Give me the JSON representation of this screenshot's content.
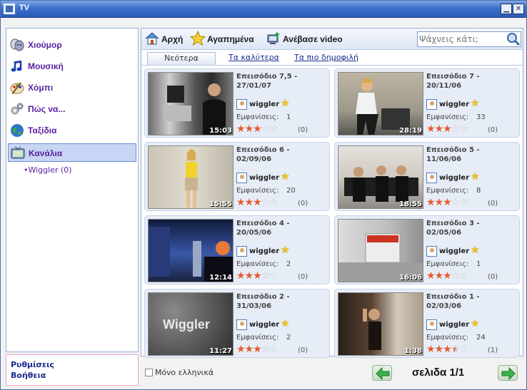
{
  "window": {
    "title": "TV",
    "minimize_glyph": "▁",
    "close_glyph": "✕"
  },
  "sidebar": {
    "categories": [
      {
        "label": "Χιούμορ",
        "icon": "theater-masks-icon"
      },
      {
        "label": "Μουσική",
        "icon": "music-note-icon"
      },
      {
        "label": "Χόμπι",
        "icon": "palette-icon"
      },
      {
        "label": "Πώς να...",
        "icon": "gears-icon"
      },
      {
        "label": "Ταξίδια",
        "icon": "globe-icon"
      },
      {
        "label": "Κανάλια",
        "icon": "tv-channels-icon"
      }
    ],
    "sub_item": "•Wiggler (0)",
    "footer": {
      "settings": "Ρυθμίσεις",
      "help": "Βοήθεια"
    }
  },
  "toolbar": {
    "home": "Αρχή",
    "favorites": "Αγαπημένα",
    "upload": "Ανέβασε video",
    "search_placeholder": "Ψάχνεις κάτι;"
  },
  "tabs": {
    "newest": "Νεότερα",
    "best": "Τα καλύτερα",
    "popular": "Τα πιο δημοφιλή"
  },
  "videos": [
    {
      "title": "Επεισόδιο 7,5 - 27/01/07",
      "user": "wiggler",
      "views_label": "Εμφανίσεις:",
      "views": "1",
      "rating": 3,
      "rating_count": "(0)",
      "duration": "15:03"
    },
    {
      "title": "Επεισόδιο 7 - 20/11/06",
      "user": "wiggler",
      "views_label": "Εμφανίσεις:",
      "views": "33",
      "rating": 3,
      "rating_count": "(0)",
      "duration": "28:19"
    },
    {
      "title": "Επεισόδιο 6 - 02/09/06",
      "user": "wiggler",
      "views_label": "Εμφανίσεις:",
      "views": "20",
      "rating": 3,
      "rating_count": "(0)",
      "duration": "15:55"
    },
    {
      "title": "Επεισόδιο 5 - 11/06/06",
      "user": "wiggler",
      "views_label": "Εμφανίσεις:",
      "views": "8",
      "rating": 3,
      "rating_count": "(0)",
      "duration": "18:55"
    },
    {
      "title": "Επεισόδιο 4 - 20/05/06",
      "user": "wiggler",
      "views_label": "Εμφανίσεις:",
      "views": "2",
      "rating": 3,
      "rating_count": "(0)",
      "duration": "12:14"
    },
    {
      "title": "Επεισόδιο 3 - 02/05/06",
      "user": "wiggler",
      "views_label": "Εμφανίσεις:",
      "views": "1",
      "rating": 3,
      "rating_count": "(0)",
      "duration": "16:06"
    },
    {
      "title": "Επεισόδιο 2 - 31/03/06",
      "user": "wiggler",
      "views_label": "Εμφανίσεις:",
      "views": "2",
      "rating": 3,
      "rating_count": "(0)",
      "duration": "11:27",
      "thumb_text": "Wiggler"
    },
    {
      "title": "Επεισόδιο 1 - 02/03/06",
      "user": "wiggler",
      "views_label": "Εμφανίσεις:",
      "views": "24",
      "rating": 3.5,
      "rating_count": "(1)",
      "duration": "1:38"
    }
  ],
  "footer": {
    "only_greek": "Μόνο ελληνικά",
    "page_label": "σελιδα 1/1"
  },
  "colors": {
    "accent": "#5a1ea0",
    "link": "#1c2c8f",
    "star_fill": "#e35b2b",
    "fav_star": "#f0c31e"
  }
}
